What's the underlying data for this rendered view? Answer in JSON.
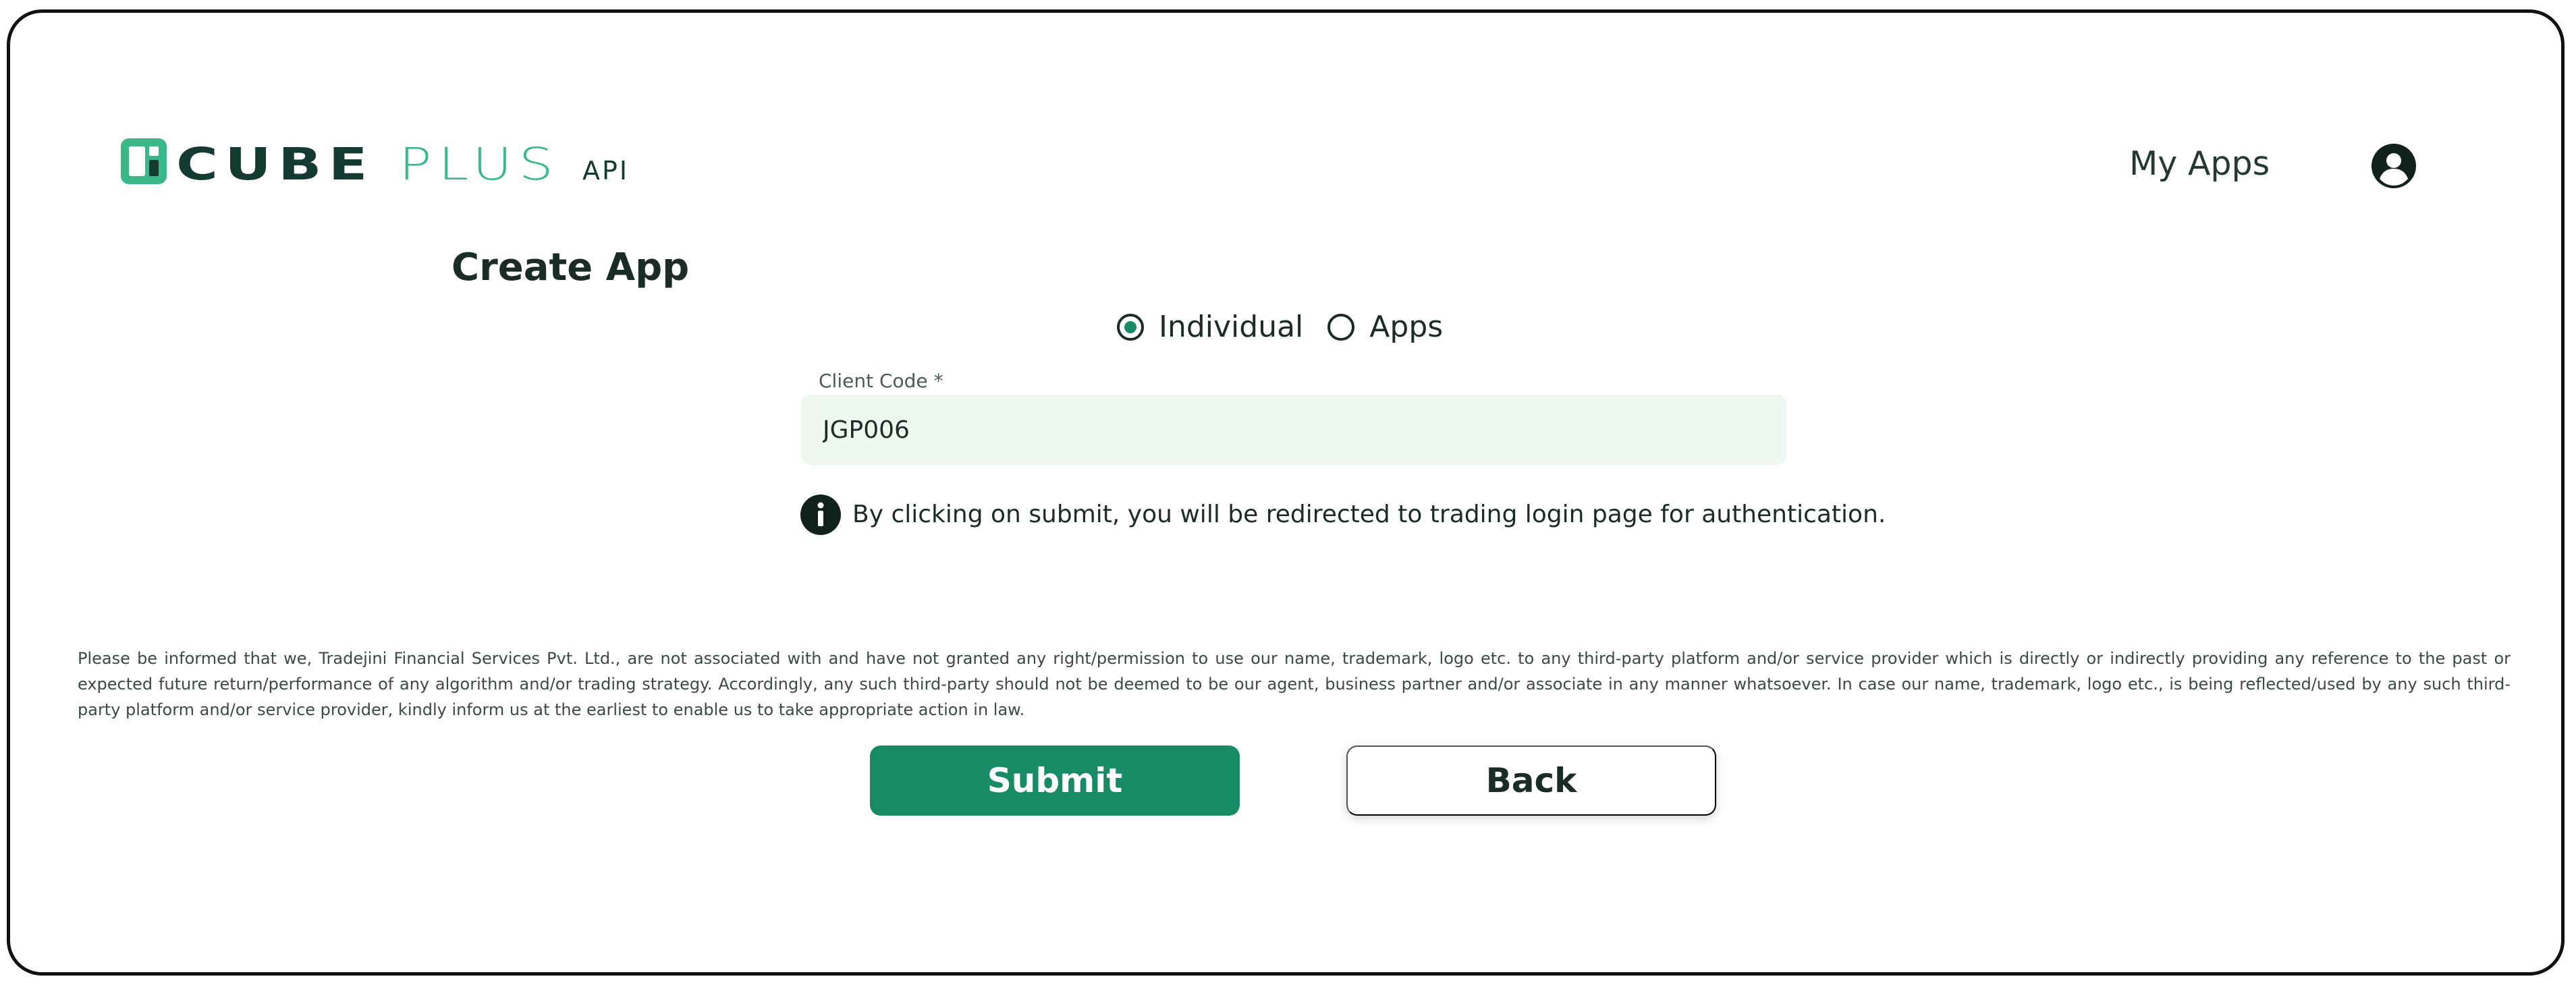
{
  "colors": {
    "brand_dark": "#143b31",
    "brand_light": "#3bb88a",
    "accent": "#178a66",
    "field_bg": "#eef8f0"
  },
  "header": {
    "logo_dark": "CUBE",
    "logo_light": "PLUS",
    "logo_api": "API",
    "nav_my_apps": "My Apps",
    "avatar_icon": "user-circle-icon"
  },
  "form": {
    "title": "Create App",
    "radio_options": [
      {
        "label": "Individual",
        "selected": true
      },
      {
        "label": "Apps",
        "selected": false
      }
    ],
    "client_code": {
      "label": "Client Code",
      "required_mark": "*",
      "value": "JGP006"
    },
    "info_icon": "info-icon",
    "info_text": "By clicking on submit, you will be redirected to trading login page for authentication."
  },
  "disclaimer": "Please be informed that we, Tradejini Financial Services Pvt. Ltd., are not associated with and have not granted any right/permission to use our name, trademark, logo etc. to any third-party platform and/or service provider which is directly or indirectly providing any reference to the past or expected future return/performance of any algorithm and/or trading strategy. Accordingly, any such third-party should not be deemed to be our agent, business partner and/or associate in any manner whatsoever. In case our name, trademark, logo etc., is being reflected/used by any such third-party platform and/or service provider, kindly inform us at the earliest to enable us to take appropriate action in law.",
  "actions": {
    "submit_label": "Submit",
    "back_label": "Back"
  }
}
